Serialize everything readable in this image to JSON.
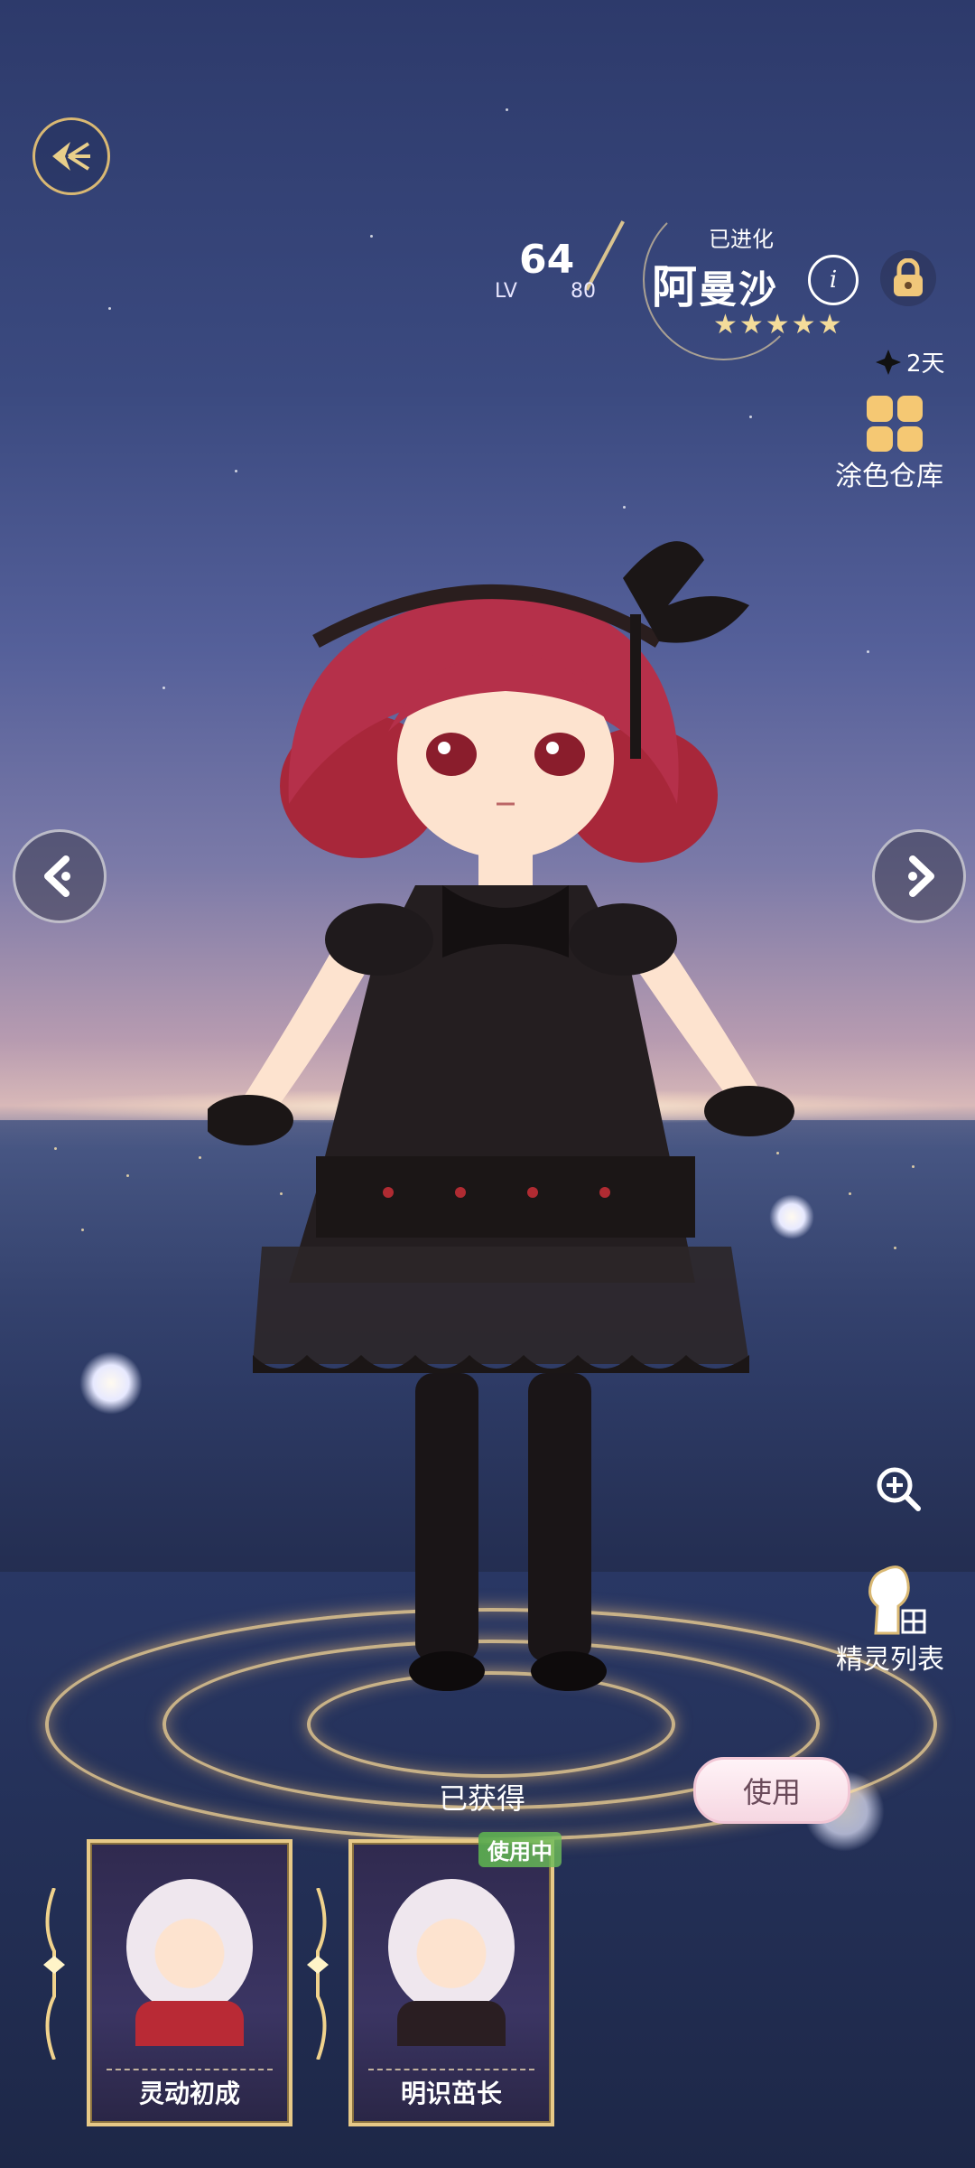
{
  "header": {
    "level": "64",
    "level_prefix": "LV",
    "level_max": "80",
    "status": "已进化",
    "name_first": "阿",
    "name_rest": "曼沙",
    "stars": "★★★★★",
    "timer": "2天",
    "color_warehouse_label": "涂色仓库"
  },
  "right_tools": {
    "spirit_list_label": "精灵列表"
  },
  "costume": {
    "obtained_label": "已获得",
    "use_label": "使用",
    "in_use_badge": "使用中",
    "cards": [
      {
        "label": "灵动初成"
      },
      {
        "label": "明识茁长"
      }
    ]
  },
  "colors": {
    "gold": "#e7c987",
    "hair": "#a8273a",
    "dress": "#1f1a1c",
    "sky_top": "#2d3a6b"
  },
  "icons": [
    "back-icon",
    "edit-icon",
    "lock-icon",
    "diamond-icon",
    "palette-icon",
    "chevron-left-icon",
    "chevron-right-icon",
    "zoom-in-icon",
    "spirit-list-icon"
  ]
}
